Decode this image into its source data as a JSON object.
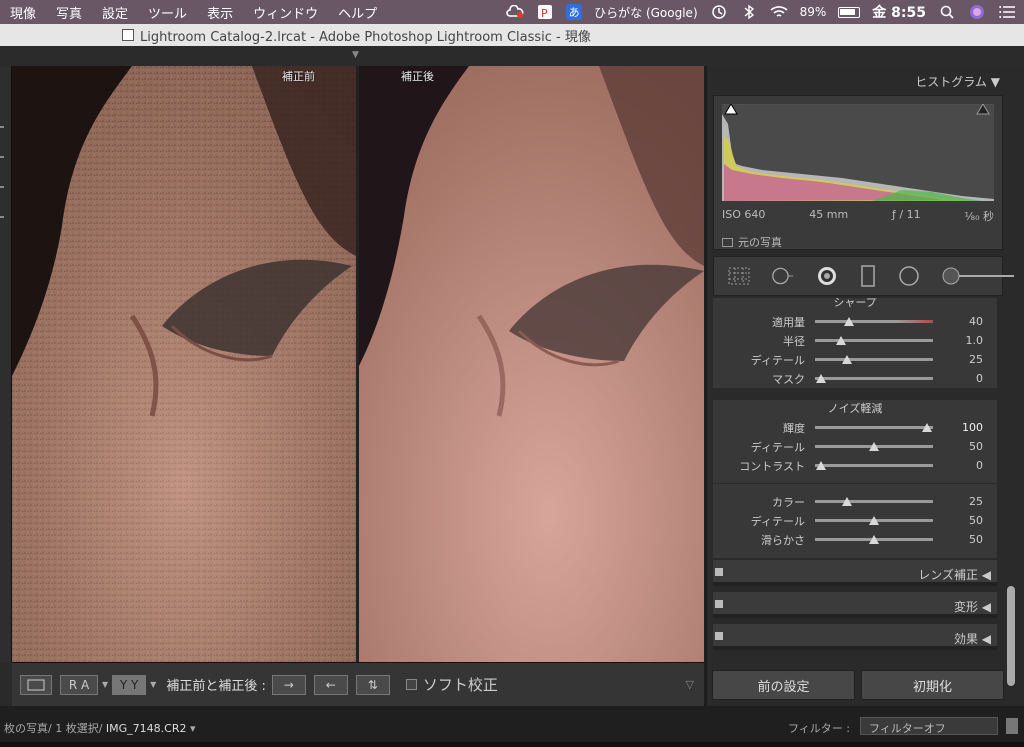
{
  "menubar": {
    "items": [
      "現像",
      "写真",
      "設定",
      "ツール",
      "表示",
      "ウィンドウ",
      "ヘルプ"
    ],
    "ime_label": "あ",
    "ime_name": "ひらがな (Google)",
    "battery": "89%",
    "clock": "金 8:55"
  },
  "window": {
    "title": "Lightroom Catalog-2.lrcat - Adobe Photoshop Lightroom Classic - 現像"
  },
  "view": {
    "before_label": "補正前",
    "after_label": "補正後"
  },
  "toolbar": {
    "compare_label": "補正前と補正後 :",
    "ra": "R A",
    "yy": "Y Y",
    "softproof": "ソフト校正"
  },
  "histogram": {
    "title": "ヒストグラム",
    "iso": "ISO 640",
    "focal": "45 mm",
    "aperture": "ƒ / 11",
    "shutter": "¹⁄₈₀ 秒",
    "original": "元の写真"
  },
  "sharpen": {
    "title": "シャープ",
    "rows": [
      {
        "label": "適用量",
        "value": "40",
        "pos": 0.29
      },
      {
        "label": "半径",
        "value": "1.0",
        "pos": 0.22
      },
      {
        "label": "ディテール",
        "value": "25",
        "pos": 0.27
      },
      {
        "label": "マスク",
        "value": "0",
        "pos": 0.05
      }
    ]
  },
  "noise": {
    "title": "ノイズ軽減",
    "luminance_rows": [
      {
        "label": "輝度",
        "value": "100",
        "pos": 0.95
      },
      {
        "label": "ディテール",
        "value": "50",
        "pos": 0.5
      },
      {
        "label": "コントラスト",
        "value": "0",
        "pos": 0.05
      }
    ],
    "color_rows": [
      {
        "label": "カラー",
        "value": "25",
        "pos": 0.27
      },
      {
        "label": "ディテール",
        "value": "50",
        "pos": 0.5
      },
      {
        "label": "滑らかさ",
        "value": "50",
        "pos": 0.5
      }
    ]
  },
  "panels": {
    "lens": "レンズ補正",
    "transform": "変形",
    "effects": "効果"
  },
  "buttons": {
    "previous": "前の設定",
    "reset": "初期化"
  },
  "status": {
    "crumb": "枚の写真/ 1 枚選択/",
    "filename": "IMG_7148.CR2",
    "filter_label": "フィルター :",
    "filter_value": "フィルターオフ"
  }
}
